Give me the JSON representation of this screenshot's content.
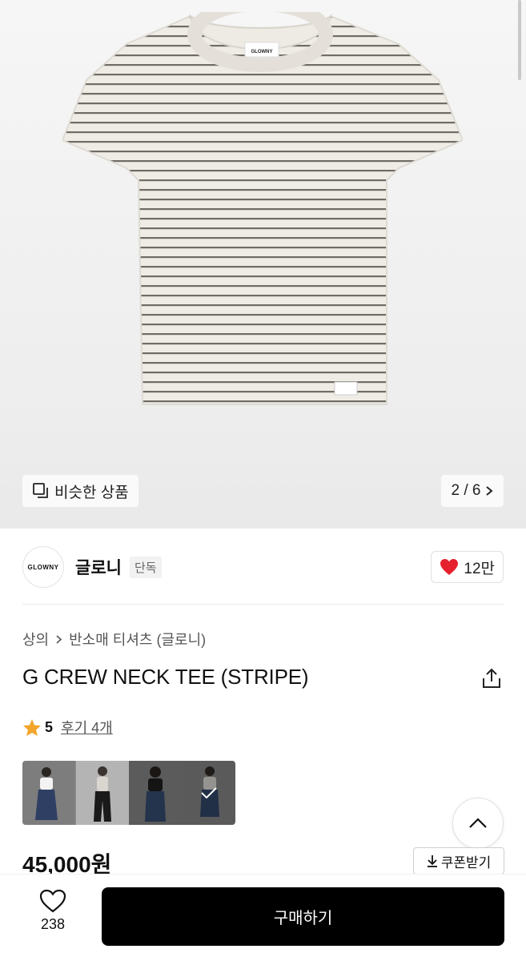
{
  "gallery": {
    "tee_label": "GLOWNY",
    "similar_label": "비슷한 상품",
    "pager": "2 / 6"
  },
  "brand": {
    "logo_text": "GLOWNY",
    "name": "글로니",
    "badge": "단독",
    "likes": "12만"
  },
  "breadcrumb": {
    "category": "상의",
    "subcategory": "반소매 티셔츠 (글로니)"
  },
  "product": {
    "title": "G CREW NECK TEE (STRIPE)",
    "rating": "5",
    "review_link": "후기 4개",
    "price": "45,000원",
    "coupon_label": "쿠폰받기"
  },
  "bottom_bar": {
    "wish_count": "238",
    "buy_label": "구매하기"
  },
  "colors": {
    "accent": "#000000",
    "star": "#f2a52b",
    "heart": "#e5212d"
  },
  "icons": [
    "similar-icon",
    "chevron-right-icon",
    "heart-icon",
    "share-icon",
    "star-icon",
    "chevron-up-icon",
    "download-icon",
    "check-icon"
  ]
}
